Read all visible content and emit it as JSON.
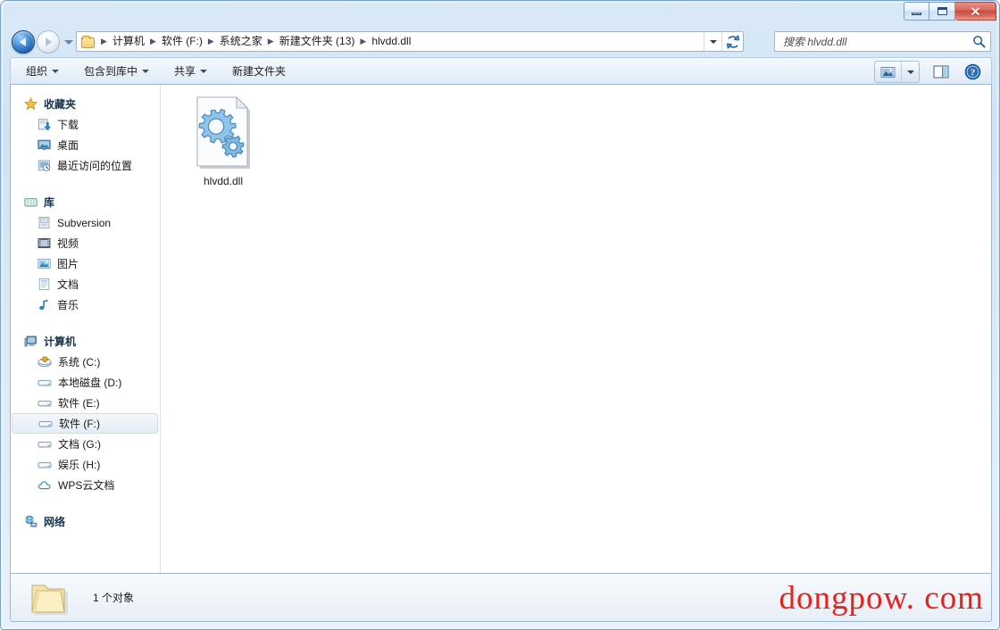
{
  "window": {
    "minimize_label": "最小化",
    "maximize_label": "最大化",
    "close_label": "✕",
    "frame_color": "#7ba4cc"
  },
  "address_bar": {
    "back_tooltip": "后退",
    "forward_tooltip": "前进",
    "history_tooltip": "最近浏览的位置",
    "crumbs": [
      {
        "label": "计算机"
      },
      {
        "label": "软件 (F:)"
      },
      {
        "label": "系统之家"
      },
      {
        "label": "新建文件夹 (13)"
      },
      {
        "label": "hlvdd.dll"
      }
    ],
    "separator": "▶",
    "dropdown_tooltip": "以前的位置",
    "refresh_tooltip": "刷新"
  },
  "search": {
    "placeholder": "搜索 hlvdd.dll",
    "value": ""
  },
  "toolbar": {
    "buttons": [
      {
        "label": "组织",
        "has_caret": true
      },
      {
        "label": "包含到库中",
        "has_caret": true
      },
      {
        "label": "共享",
        "has_caret": true
      },
      {
        "label": "新建文件夹",
        "has_caret": false
      }
    ],
    "view_tooltip": "更改您的视图",
    "preview_tooltip": "显示预览窗格",
    "help_tooltip": "获取帮助"
  },
  "sidebar": {
    "groups": [
      {
        "header": "收藏夹",
        "header_icon": "star-icon",
        "items": [
          {
            "label": "下载",
            "icon": "download-icon",
            "selected": false
          },
          {
            "label": "桌面",
            "icon": "desktop-icon",
            "selected": false
          },
          {
            "label": "最近访问的位置",
            "icon": "recent-places-icon",
            "selected": false
          }
        ]
      },
      {
        "header": "库",
        "header_icon": "library-icon",
        "items": [
          {
            "label": "Subversion",
            "icon": "subversion-icon",
            "selected": false
          },
          {
            "label": "视频",
            "icon": "video-icon",
            "selected": false
          },
          {
            "label": "图片",
            "icon": "pictures-icon",
            "selected": false
          },
          {
            "label": "文档",
            "icon": "documents-icon",
            "selected": false
          },
          {
            "label": "音乐",
            "icon": "music-icon",
            "selected": false
          }
        ]
      },
      {
        "header": "计算机",
        "header_icon": "computer-icon",
        "items": [
          {
            "label": "系统 (C:)",
            "icon": "system-drive-icon",
            "selected": false
          },
          {
            "label": "本地磁盘 (D:)",
            "icon": "drive-icon",
            "selected": false
          },
          {
            "label": "软件 (E:)",
            "icon": "drive-icon",
            "selected": false
          },
          {
            "label": "软件 (F:)",
            "icon": "drive-icon",
            "selected": true
          },
          {
            "label": "文档 (G:)",
            "icon": "drive-icon",
            "selected": false
          },
          {
            "label": "娱乐 (H:)",
            "icon": "drive-icon",
            "selected": false
          },
          {
            "label": "WPS云文档",
            "icon": "cloud-icon",
            "selected": false
          }
        ]
      },
      {
        "header": "网络",
        "header_icon": "network-icon",
        "items": []
      }
    ]
  },
  "files": [
    {
      "name": "hlvdd.dll",
      "icon": "dll-gear-icon",
      "selected": false
    }
  ],
  "status": {
    "text": "1 个对象",
    "icon": "folder-icon"
  },
  "watermark": {
    "text": "dongpow. com",
    "color": "#e8211a"
  }
}
